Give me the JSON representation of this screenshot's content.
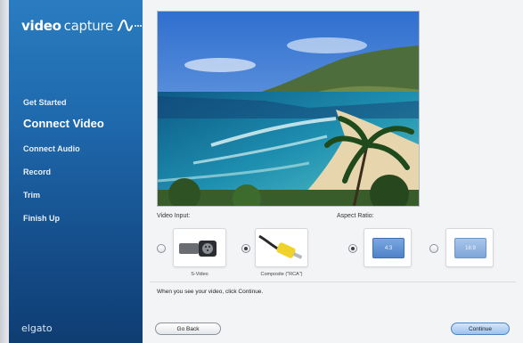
{
  "app": {
    "brand_bold": "video",
    "brand_light": "capture",
    "brand_icon": "waveform-icon"
  },
  "sidebar": {
    "steps": [
      {
        "label": "Get Started",
        "active": false
      },
      {
        "label": "Connect Video",
        "active": true
      },
      {
        "label": "Connect Audio",
        "active": false
      },
      {
        "label": "Record",
        "active": false
      },
      {
        "label": "Trim",
        "active": false
      },
      {
        "label": "Finish Up",
        "active": false
      }
    ],
    "footer": "elgato"
  },
  "main": {
    "preview_image": "video-preview-beach-coastline",
    "video_input": {
      "label": "Video Input:",
      "options": [
        {
          "caption": "S-Video",
          "selected": false,
          "icon": "svideo-connector-icon"
        },
        {
          "caption": "Composite (\"RCA\")",
          "selected": true,
          "icon": "rca-connector-icon"
        }
      ]
    },
    "aspect_ratio": {
      "label": "Aspect Ratio:",
      "options": [
        {
          "label": "4:3",
          "selected": true
        },
        {
          "label": "16:9",
          "selected": false
        }
      ]
    },
    "hint": "When you see your video, click Continue.",
    "back_label": "Go Back",
    "continue_label": "Continue"
  },
  "colors": {
    "sidebar": "#1f69ad",
    "accent": "#4f82c8"
  }
}
